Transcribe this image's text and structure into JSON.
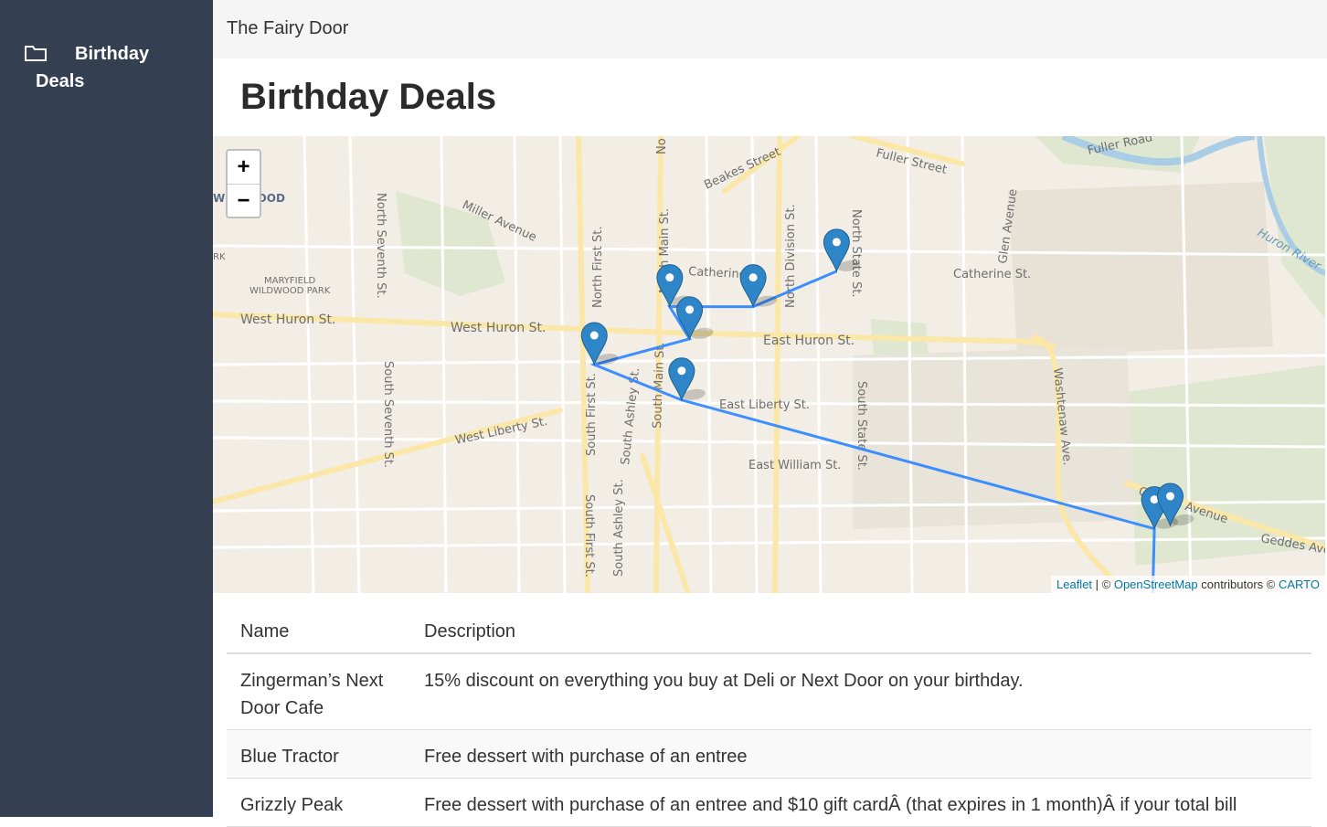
{
  "sidebar": {
    "items": [
      {
        "label_line1": "Birthday",
        "label_line2": "Deals",
        "icon": "folder-icon"
      }
    ]
  },
  "topbar": {
    "brand": "The Fairy Door"
  },
  "page": {
    "title": "Birthday Deals"
  },
  "map": {
    "zoom_in": "+",
    "zoom_out": "−",
    "attribution": {
      "leaflet": "Leaflet",
      "sep1": " | © ",
      "osm": "OpenStreetMap",
      "contrib": " contributors © ",
      "carto": "CARTO"
    },
    "labels": [
      "Fuller Road",
      "Fuller Street",
      "Beakes Street",
      "Miller Avenue",
      "North Seventh St.",
      "North First St.",
      "North Main St.",
      "North Division St.",
      "North State St.",
      "Glen Avenue",
      "Huron River",
      "Catherine St.",
      "Catherine St.",
      "MARYFIELD",
      "WILDWOOD PARK",
      "West Huron St.",
      "West Huron St.",
      "East Huron St.",
      "South Seventh St.",
      "East Liberty St.",
      "West Liberty St.",
      "South First St.",
      "South Ashley St.",
      "South Main St.",
      "South State St.",
      "East William St.",
      "Washtenaw Ave.",
      "Geddes Avenue",
      "Geddes Ave",
      "WILDWOOD",
      "RK",
      "No",
      "South First St.",
      "South Ashley St."
    ],
    "route_color": "#3388ff",
    "marker_color": "#2e86c9",
    "markers": [
      {
        "lat": 42.2823,
        "lng": -83.7463
      },
      {
        "lat": 42.2812,
        "lng": -83.7484
      },
      {
        "lat": 42.2812,
        "lng": -83.7505
      },
      {
        "lat": 42.2802,
        "lng": -83.75
      },
      {
        "lat": 42.2794,
        "lng": -83.7524
      },
      {
        "lat": 42.2783,
        "lng": -83.7502
      },
      {
        "lat": 42.2743,
        "lng": -83.7383
      },
      {
        "lat": 42.2744,
        "lng": -83.7379
      }
    ]
  },
  "table": {
    "headers": [
      "Name",
      "Description"
    ],
    "rows": [
      {
        "name": "Zingerman’s Next Door Cafe",
        "description": "15% discount on everything you buy at Deli or Next Door on your birthday."
      },
      {
        "name": "Blue Tractor",
        "description": "Free dessert with purchase of an entree"
      },
      {
        "name": "Grizzly Peak",
        "description": "Free dessert with purchase of an entree and $10 gift cardÂ (that expires in 1 month)Â if your total bill"
      }
    ]
  }
}
